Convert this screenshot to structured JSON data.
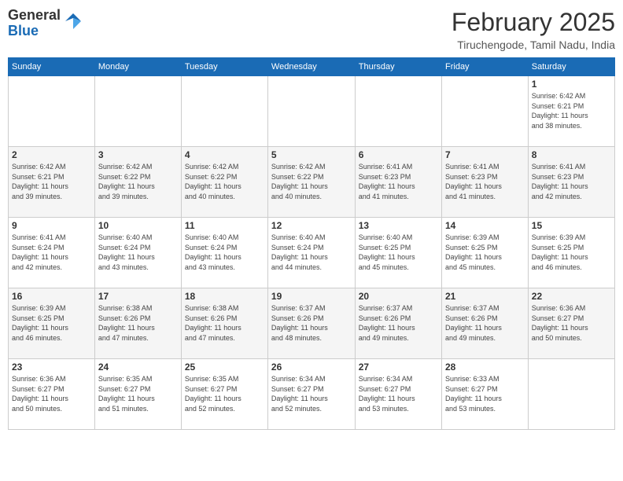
{
  "header": {
    "logo_general": "General",
    "logo_blue": "Blue",
    "month_title": "February 2025",
    "location": "Tiruchengode, Tamil Nadu, India"
  },
  "days_of_week": [
    "Sunday",
    "Monday",
    "Tuesday",
    "Wednesday",
    "Thursday",
    "Friday",
    "Saturday"
  ],
  "weeks": [
    [
      {
        "day": "",
        "info": ""
      },
      {
        "day": "",
        "info": ""
      },
      {
        "day": "",
        "info": ""
      },
      {
        "day": "",
        "info": ""
      },
      {
        "day": "",
        "info": ""
      },
      {
        "day": "",
        "info": ""
      },
      {
        "day": "1",
        "info": "Sunrise: 6:42 AM\nSunset: 6:21 PM\nDaylight: 11 hours\nand 38 minutes."
      }
    ],
    [
      {
        "day": "2",
        "info": "Sunrise: 6:42 AM\nSunset: 6:21 PM\nDaylight: 11 hours\nand 39 minutes."
      },
      {
        "day": "3",
        "info": "Sunrise: 6:42 AM\nSunset: 6:22 PM\nDaylight: 11 hours\nand 39 minutes."
      },
      {
        "day": "4",
        "info": "Sunrise: 6:42 AM\nSunset: 6:22 PM\nDaylight: 11 hours\nand 40 minutes."
      },
      {
        "day": "5",
        "info": "Sunrise: 6:42 AM\nSunset: 6:22 PM\nDaylight: 11 hours\nand 40 minutes."
      },
      {
        "day": "6",
        "info": "Sunrise: 6:41 AM\nSunset: 6:23 PM\nDaylight: 11 hours\nand 41 minutes."
      },
      {
        "day": "7",
        "info": "Sunrise: 6:41 AM\nSunset: 6:23 PM\nDaylight: 11 hours\nand 41 minutes."
      },
      {
        "day": "8",
        "info": "Sunrise: 6:41 AM\nSunset: 6:23 PM\nDaylight: 11 hours\nand 42 minutes."
      }
    ],
    [
      {
        "day": "9",
        "info": "Sunrise: 6:41 AM\nSunset: 6:24 PM\nDaylight: 11 hours\nand 42 minutes."
      },
      {
        "day": "10",
        "info": "Sunrise: 6:40 AM\nSunset: 6:24 PM\nDaylight: 11 hours\nand 43 minutes."
      },
      {
        "day": "11",
        "info": "Sunrise: 6:40 AM\nSunset: 6:24 PM\nDaylight: 11 hours\nand 43 minutes."
      },
      {
        "day": "12",
        "info": "Sunrise: 6:40 AM\nSunset: 6:24 PM\nDaylight: 11 hours\nand 44 minutes."
      },
      {
        "day": "13",
        "info": "Sunrise: 6:40 AM\nSunset: 6:25 PM\nDaylight: 11 hours\nand 45 minutes."
      },
      {
        "day": "14",
        "info": "Sunrise: 6:39 AM\nSunset: 6:25 PM\nDaylight: 11 hours\nand 45 minutes."
      },
      {
        "day": "15",
        "info": "Sunrise: 6:39 AM\nSunset: 6:25 PM\nDaylight: 11 hours\nand 46 minutes."
      }
    ],
    [
      {
        "day": "16",
        "info": "Sunrise: 6:39 AM\nSunset: 6:25 PM\nDaylight: 11 hours\nand 46 minutes."
      },
      {
        "day": "17",
        "info": "Sunrise: 6:38 AM\nSunset: 6:26 PM\nDaylight: 11 hours\nand 47 minutes."
      },
      {
        "day": "18",
        "info": "Sunrise: 6:38 AM\nSunset: 6:26 PM\nDaylight: 11 hours\nand 47 minutes."
      },
      {
        "day": "19",
        "info": "Sunrise: 6:37 AM\nSunset: 6:26 PM\nDaylight: 11 hours\nand 48 minutes."
      },
      {
        "day": "20",
        "info": "Sunrise: 6:37 AM\nSunset: 6:26 PM\nDaylight: 11 hours\nand 49 minutes."
      },
      {
        "day": "21",
        "info": "Sunrise: 6:37 AM\nSunset: 6:26 PM\nDaylight: 11 hours\nand 49 minutes."
      },
      {
        "day": "22",
        "info": "Sunrise: 6:36 AM\nSunset: 6:27 PM\nDaylight: 11 hours\nand 50 minutes."
      }
    ],
    [
      {
        "day": "23",
        "info": "Sunrise: 6:36 AM\nSunset: 6:27 PM\nDaylight: 11 hours\nand 50 minutes."
      },
      {
        "day": "24",
        "info": "Sunrise: 6:35 AM\nSunset: 6:27 PM\nDaylight: 11 hours\nand 51 minutes."
      },
      {
        "day": "25",
        "info": "Sunrise: 6:35 AM\nSunset: 6:27 PM\nDaylight: 11 hours\nand 52 minutes."
      },
      {
        "day": "26",
        "info": "Sunrise: 6:34 AM\nSunset: 6:27 PM\nDaylight: 11 hours\nand 52 minutes."
      },
      {
        "day": "27",
        "info": "Sunrise: 6:34 AM\nSunset: 6:27 PM\nDaylight: 11 hours\nand 53 minutes."
      },
      {
        "day": "28",
        "info": "Sunrise: 6:33 AM\nSunset: 6:27 PM\nDaylight: 11 hours\nand 53 minutes."
      },
      {
        "day": "",
        "info": ""
      }
    ]
  ]
}
